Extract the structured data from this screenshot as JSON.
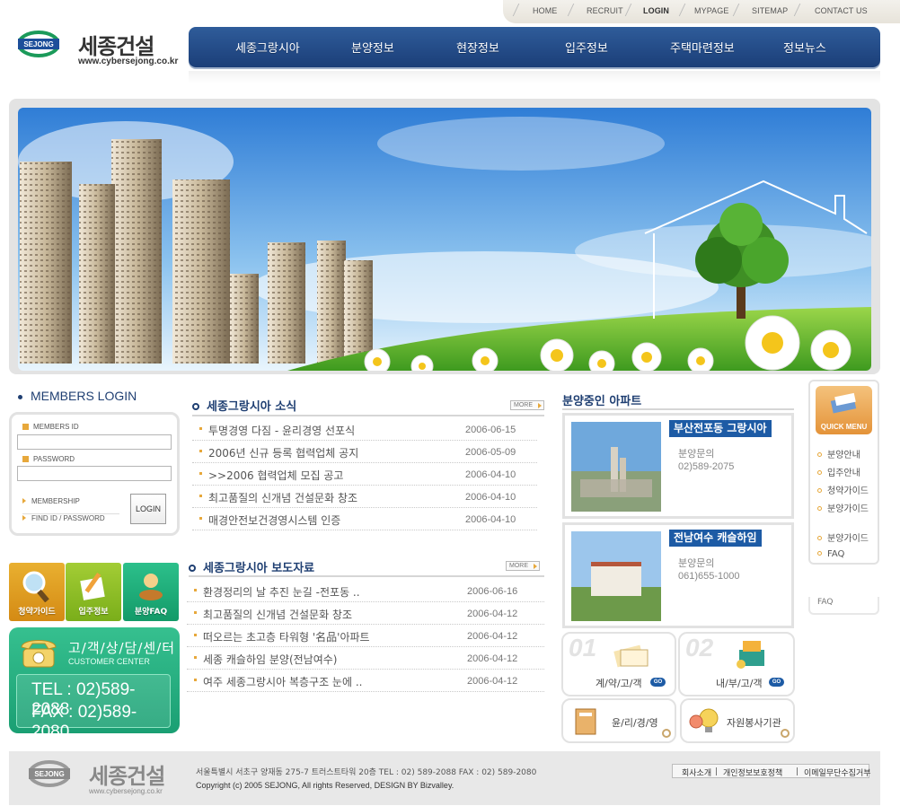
{
  "top_links": [
    "HOME",
    "RECRUIT",
    "LOGIN",
    "MYPAGE",
    "SITEMAP",
    "CONTACT US"
  ],
  "logo": {
    "mark": "SEJONG",
    "name": "세종건설",
    "url": "www.cybersejong.co.kr"
  },
  "nav": [
    "세종그랑시아",
    "분양정보",
    "현장정보",
    "입주정보",
    "주택마련정보",
    "정보뉴스"
  ],
  "members": {
    "title": "MEMBERS LOGIN",
    "id_label": "MEMBERS ID",
    "pw_label": "PASSWORD",
    "id_value": "",
    "pw_value": "",
    "membership": "MEMBERSHIP",
    "find": "FIND ID / PASSWORD",
    "login": "LOGIN"
  },
  "tiles": [
    {
      "label": "청약가이드",
      "color": "#e3a022"
    },
    {
      "label": "입주정보",
      "color": "#8cbd26"
    },
    {
      "label": "분양FAQ",
      "color": "#1fae79"
    }
  ],
  "customer_center": {
    "title_ko": "고/객/상/담/센/터",
    "title_en": "CUSTOMER CENTER",
    "tel": "TEL : 02)589-2088",
    "fax": "FAX : 02)589-2080"
  },
  "news": {
    "title": "세종그랑시아 소식",
    "more": "MORE",
    "items": [
      {
        "title": "투명경영 다짐 - 윤리경영 선포식",
        "date": "2006-06-15"
      },
      {
        "title": "2006년 신규 등록 협력업체 공지",
        "date": "2006-05-09"
      },
      {
        "title": ">>2006 협력업체 모집 공고",
        "date": "2006-04-10"
      },
      {
        "title": "최고품질의 신개념 건설문화 창조",
        "date": "2006-04-10"
      },
      {
        "title": "매경안전보건경영시스템 인증",
        "date": "2006-04-10"
      }
    ]
  },
  "press": {
    "title": "세종그랑시아 보도자료",
    "more": "MORE",
    "items": [
      {
        "title": "환경정리의 날 추진 눈길 -전포동 ..",
        "date": "2006-06-16"
      },
      {
        "title": "최고품질의 신개념 건설문화 창조",
        "date": "2006-04-12"
      },
      {
        "title": "떠오르는 초고층 타워형 '名品'아파트",
        "date": "2006-04-12"
      },
      {
        "title": "세종 캐슬하임 분양(전남여수)",
        "date": "2006-04-12"
      },
      {
        "title": "여주 세종그랑시아 복층구조 눈에 ..",
        "date": "2006-04-12"
      }
    ]
  },
  "apartments": {
    "title": "분양중인 아파트",
    "items": [
      {
        "name": "부산전포동 그랑시아",
        "label": "분양문의",
        "tel": "02)589-2075"
      },
      {
        "name": "전남여수 캐슬하임",
        "label": "분양문의",
        "tel": "061)655-1000"
      }
    ]
  },
  "mini_cards": [
    {
      "num": "01",
      "label": "계/약/고/객",
      "go": "GO"
    },
    {
      "num": "02",
      "label": "내/부/고/객",
      "go": "GO"
    },
    {
      "label": "윤/리/경/영"
    },
    {
      "label": "자원봉사기관"
    }
  ],
  "quick_menu": {
    "title": "QUICK MENU",
    "items": [
      "분양안내",
      "입주안내",
      "청약가이드",
      "분양가이드",
      "분양가이드",
      "FAQ"
    ],
    "ghost": "FAQ"
  },
  "footer": {
    "logo_name": "세종건설",
    "logo_url": "www.cybersejong.co.kr",
    "address": "서울특별시 서초구 양재동 275-7 트러스트타워 20층  TEL : 02) 589-2088   FAX : 02) 589-2080",
    "copyright": "Copyright (c) 2005 SEJONG, All rights Reserved, DESIGN BY Bizvalley.",
    "links": [
      "회사소개",
      "개인정보보호정책",
      "이메일무단수집거부"
    ]
  }
}
